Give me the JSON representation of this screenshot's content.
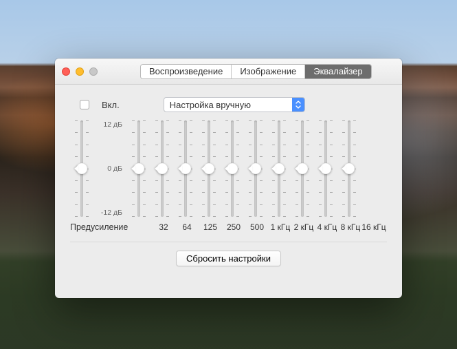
{
  "tabs": {
    "items": [
      {
        "label": "Воспроизведение",
        "active": false
      },
      {
        "label": "Изображение",
        "active": false
      },
      {
        "label": "Эквалайзер",
        "active": true
      }
    ]
  },
  "enable": {
    "label": "Вкл.",
    "checked": false
  },
  "preset": {
    "value": "Настройка вручную"
  },
  "scale": {
    "max": "12 дБ",
    "mid": "0 дБ",
    "min": "-12 дБ"
  },
  "preamp": {
    "label": "Предусиление",
    "value": 0
  },
  "bands": [
    {
      "freq": "32",
      "value": 0
    },
    {
      "freq": "64",
      "value": 0
    },
    {
      "freq": "125",
      "value": 0
    },
    {
      "freq": "250",
      "value": 0
    },
    {
      "freq": "500",
      "value": 0
    },
    {
      "freq": "1 кГц",
      "value": 0
    },
    {
      "freq": "2 кГц",
      "value": 0
    },
    {
      "freq": "4 кГц",
      "value": 0
    },
    {
      "freq": "8 кГц",
      "value": 0
    },
    {
      "freq": "16 кГц",
      "value": 0
    }
  ],
  "reset": {
    "label": "Сбросить настройки"
  }
}
